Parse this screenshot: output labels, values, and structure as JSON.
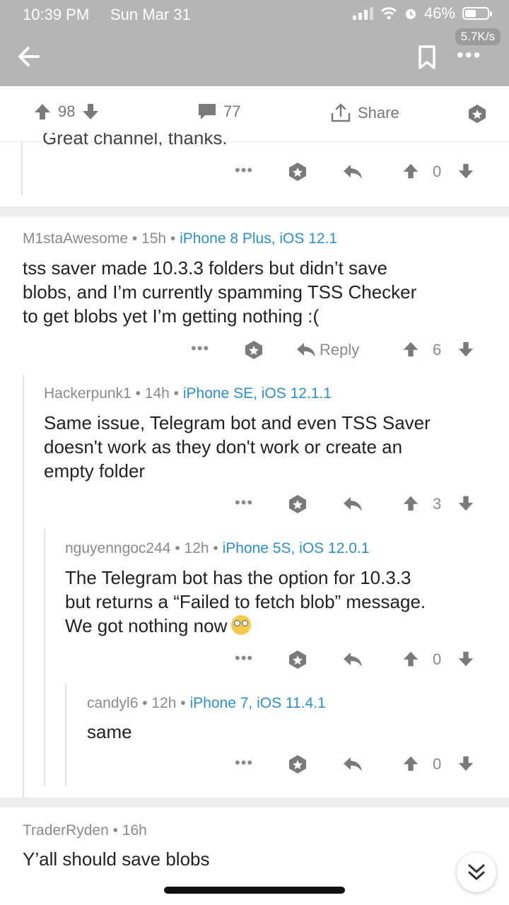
{
  "status_bar": {
    "time": "10:39 PM",
    "date": "Sun Mar 31",
    "battery": "46%",
    "speed": "5.7K/s"
  },
  "post": {
    "upvotes": "98",
    "comments": "77",
    "share_label": "Share"
  },
  "partial_comment": {
    "text": "Great channel, thanks.",
    "score": "0"
  },
  "comments": [
    {
      "author": "M1staAwesome",
      "age": "15h",
      "device": "iPhone 8 Plus, iOS 12.1",
      "lines": [
        "tss saver made 10.3.3 folders but didn’t save",
        "blobs, and I’m currently spamming TSS Checker",
        "to get blobs yet I’m getting nothing :("
      ],
      "reply_label": "Reply",
      "score": "6"
    },
    {
      "author": "Hackerpunk1",
      "age": "14h",
      "device": "iPhone SE, iOS 12.1.1",
      "lines": [
        "Same issue, Telegram bot and even TSS Saver",
        "doesn't work as they don't work or create an",
        "empty folder"
      ],
      "score": "3"
    },
    {
      "author": "nguyenngoc244",
      "age": "12h",
      "device": "iPhone 5S, iOS 12.0.1",
      "lines": [
        "The Telegram bot has the option for 10.3.3",
        "but returns a “Failed to fetch blob” message.",
        "We got nothing now"
      ],
      "score": "0"
    },
    {
      "author": "candyl6",
      "age": "12h",
      "device": "iPhone 7, iOS 11.4.1",
      "lines": [
        "same"
      ],
      "score": "0"
    },
    {
      "author": "TraderRyden",
      "age": "16h",
      "lines": [
        "Y’all should save blobs"
      ]
    }
  ],
  "colors": {
    "header_bg": "#b5b5b5",
    "device_link": "#2a8fd8",
    "icon_grey": "#8a8a8a"
  }
}
